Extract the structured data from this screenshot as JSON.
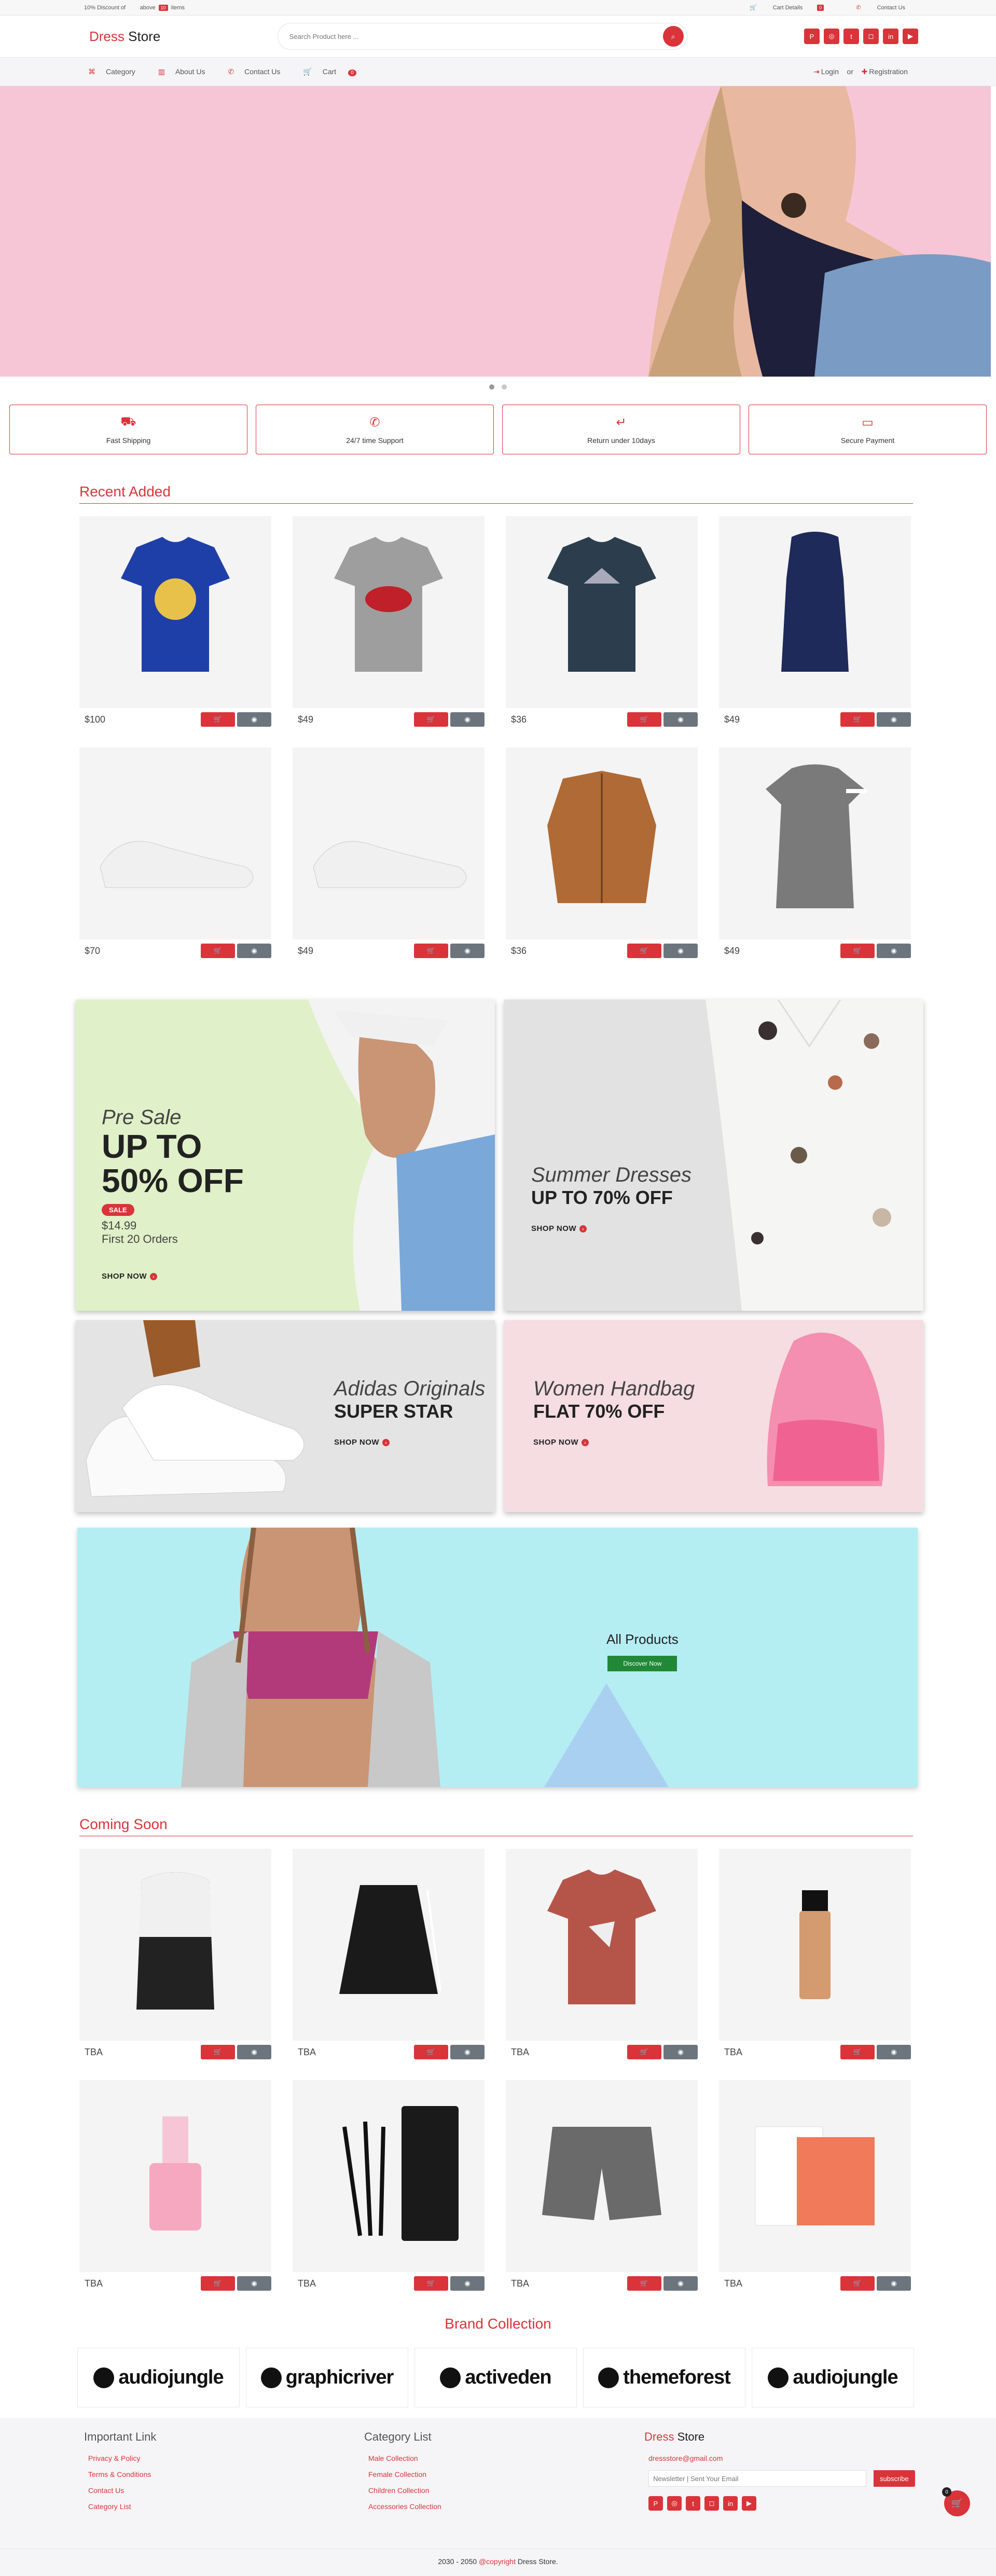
{
  "topbar": {
    "promo_prefix": "10% Discount of",
    "promo_above": "above",
    "promo_count": "10",
    "promo_suffix": "items",
    "cart_details": "Cart Details",
    "cart_details_count": "0",
    "contact_us": "Contact Us"
  },
  "header": {
    "logo_brand": "Dress",
    "logo_rest": " Store",
    "search_placeholder": "Search Product here ...",
    "socials": [
      "pinterest-icon",
      "dribbble-icon",
      "twitter-icon",
      "instagram-icon",
      "linkedin-icon",
      "youtube-icon"
    ]
  },
  "nav": {
    "items": [
      "Category",
      "About Us",
      "Contact Us",
      "Cart"
    ],
    "cart_count": "0",
    "login": "Login",
    "or": "or",
    "registration": "Registration"
  },
  "features": [
    {
      "label": "Fast Shipping",
      "icon": "truck-icon"
    },
    {
      "label": "24/7 time Support",
      "icon": "phone-icon"
    },
    {
      "label": "Return under 10days",
      "icon": "return-icon"
    },
    {
      "label": "Secure Payment",
      "icon": "credit-card-icon"
    }
  ],
  "recent": {
    "title": "Recent Added",
    "products": [
      {
        "price": "$100",
        "item": "blue-tshirt"
      },
      {
        "price": "$49",
        "item": "grey-tshirt"
      },
      {
        "price": "$36",
        "item": "navy-tshirt"
      },
      {
        "price": "$49",
        "item": "navy-dress"
      },
      {
        "price": "$70",
        "item": "white-sneaker"
      },
      {
        "price": "$49",
        "item": "white-sneaker-2"
      },
      {
        "price": "$36",
        "item": "brown-jacket"
      },
      {
        "price": "$49",
        "item": "grey-dress"
      }
    ]
  },
  "promos": {
    "p1": {
      "italic": "Pre Sale",
      "bold1": "UP TO",
      "bold2": "50% OFF",
      "badge": "SALE",
      "price": "$14.99",
      "note": "First 20 Orders",
      "cta": "SHOP NOW"
    },
    "p2": {
      "italic": "Summer Dresses",
      "bold": "UP TO 70% OFF",
      "cta": "SHOP NOW"
    },
    "p3": {
      "italic": "Adidas Originals",
      "bold": "SUPER STAR",
      "cta": "SHOP NOW"
    },
    "p4": {
      "italic": "Women Handbag",
      "bold": "FLAT 70% OFF",
      "cta": "SHOP NOW"
    }
  },
  "all_products": {
    "title": "All Products",
    "button": "Discover Now"
  },
  "coming": {
    "title": "Coming Soon",
    "products": [
      {
        "price": "TBA",
        "item": "backpack"
      },
      {
        "price": "TBA",
        "item": "skirt"
      },
      {
        "price": "TBA",
        "item": "red-tshirt"
      },
      {
        "price": "TBA",
        "item": "foundation"
      },
      {
        "price": "TBA",
        "item": "nail-polish"
      },
      {
        "price": "TBA",
        "item": "brushes"
      },
      {
        "price": "TBA",
        "item": "shorts"
      },
      {
        "price": "TBA",
        "item": "clay-soap"
      }
    ]
  },
  "brands": {
    "title": "Brand Collection",
    "items": [
      "audiojungle",
      "graphicriver",
      "activeden",
      "themeforest",
      "audiojungle"
    ]
  },
  "footer": {
    "important_title": "Important Link",
    "important_links": [
      "Privacy & Policy",
      "Terms & Conditions",
      "Contact Us",
      "Category List"
    ],
    "category_title": "Category List",
    "category_links": [
      "Male Collection",
      "Female Collection",
      "Children Collection",
      "Accessories Collection"
    ],
    "brand_first": "Dress",
    "brand_rest": " Store",
    "email": "dressstore@gmail.com",
    "newsletter_placeholder": "Newsletter | Sent Your Email",
    "subscribe": "subscribe",
    "copyright_prefix": "2030 - 2050 ",
    "copyright_link": "@copyright",
    "copyright_suffix": " Dress Store.",
    "float_cart_count": "0"
  },
  "colors": {
    "accent": "#d9343a",
    "hero_bg": "#f7c6d6",
    "all_products_bg": "#b4eef3",
    "button_grey": "#6c757d"
  }
}
